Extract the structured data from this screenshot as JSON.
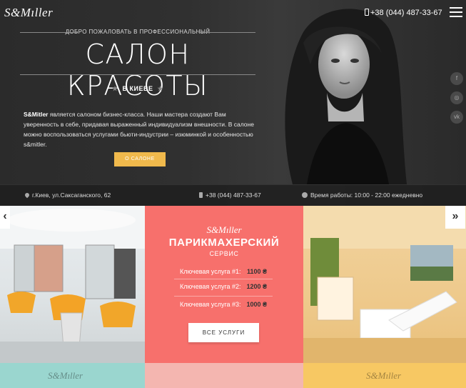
{
  "header": {
    "logo": "S&Mıller",
    "phone": "+38 (044) 487-33-67"
  },
  "hero": {
    "welcome": "ДОБРО ПОЖАЛОВАТЬ В ПРОФЕССИОНАЛЬНЫЙ",
    "title": "САЛОН КРАСОТЫ",
    "city": "В КИЕВЕ",
    "desc_brand": "S&Mitler",
    "desc_text": " является салоном бизнес-класса. Наши мастера создают Вам уверенность в себе, придавая выраженный индивидуализм внешности. В салоне можно воспользоваться услугами бьюти-индустрии – изюминкой и особенностью s&mitler.",
    "about_button": "О САЛОНЕ"
  },
  "social": {
    "items": [
      {
        "name": "facebook-icon",
        "glyph": "f"
      },
      {
        "name": "instagram-icon",
        "glyph": "◎"
      },
      {
        "name": "vk-icon",
        "glyph": "vk"
      }
    ]
  },
  "info_bar": {
    "address": "г.Киев, ул.Саксаганского, 62",
    "phone": "+38 (044) 487-33-67",
    "hours": "Время работы: 10:00 - 22:00 ежедневно"
  },
  "service_card": {
    "logo": "S&Mıller",
    "title": "ПАРИКМАХЕРСКИЙ",
    "subtitle": "СЕРВИС",
    "services": [
      {
        "label": "Ключевая услуга #1:",
        "price": "1100 ₴"
      },
      {
        "label": "Ключевая услуга #2:",
        "price": "1200 ₴"
      },
      {
        "label": "Ключевая услуга #3:",
        "price": "1000 ₴"
      }
    ],
    "all_button": "ВСЕ УСЛУГИ"
  },
  "slider": {
    "prev": "‹",
    "next": "»"
  },
  "row2": {
    "logo_left": "S&Mıller",
    "logo_right": "S&Mıller"
  }
}
